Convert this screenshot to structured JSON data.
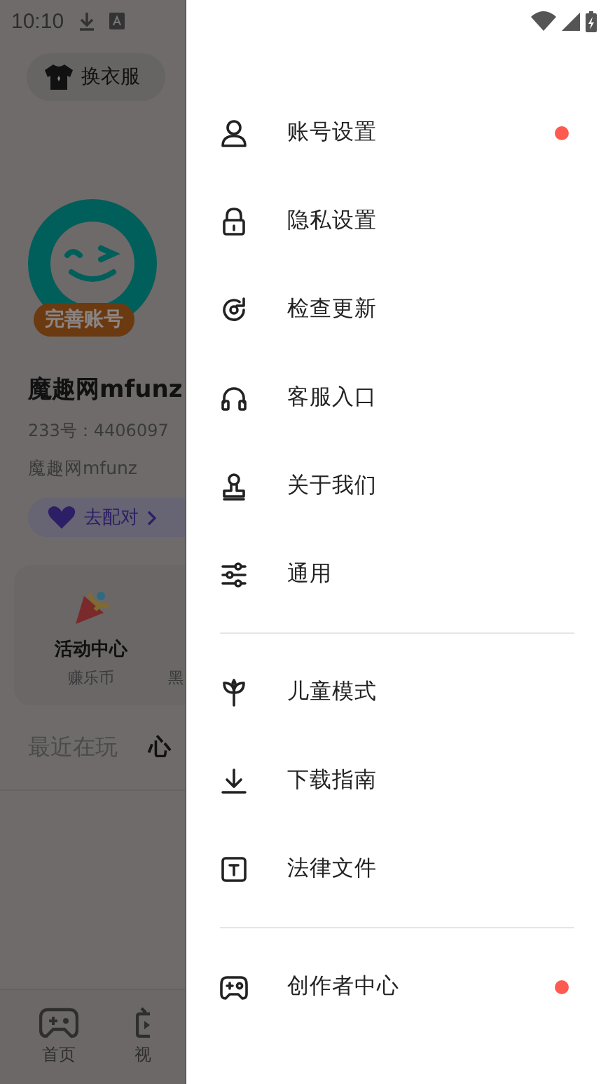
{
  "status_bar": {
    "time": "10:10"
  },
  "background": {
    "outfit_button": "换衣服",
    "avatar_badge": "完善账号",
    "name": "魔趣网mfunz",
    "id": "233号：4406097",
    "nickname": "魔趣网mfunz",
    "pair_button": "去配对",
    "card": {
      "title": "活动中心",
      "subtitle": "赚乐币",
      "next_subtitle": "黑"
    },
    "recent_tabs": [
      {
        "label": "最近在玩",
        "selected": false
      },
      {
        "label": "心",
        "selected": true
      }
    ],
    "nav": [
      {
        "label": "首页"
      },
      {
        "label": "视"
      }
    ]
  },
  "drawer": {
    "sections": [
      [
        {
          "label": "账号设置",
          "badge": true
        },
        {
          "label": "隐私设置",
          "badge": false
        },
        {
          "label": "检查更新",
          "badge": false
        },
        {
          "label": "客服入口",
          "badge": false
        },
        {
          "label": "关于我们",
          "badge": false
        },
        {
          "label": "通用",
          "badge": false
        }
      ],
      [
        {
          "label": "儿童模式",
          "badge": false
        },
        {
          "label": "下载指南",
          "badge": false
        },
        {
          "label": "法律文件",
          "badge": false
        }
      ],
      [
        {
          "label": "创作者中心",
          "badge": true
        }
      ]
    ]
  }
}
